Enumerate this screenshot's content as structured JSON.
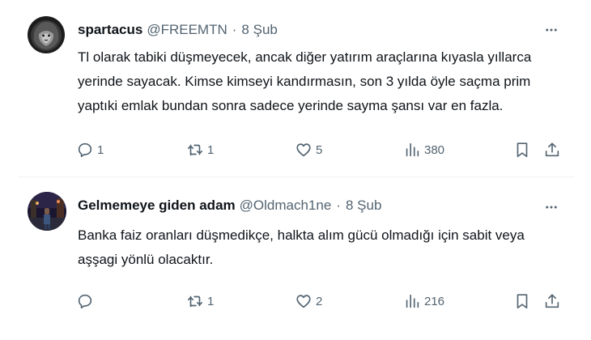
{
  "tweets": [
    {
      "name": "spartacus",
      "handle": "@FREEMTN",
      "separator": "·",
      "date": "8 Şub",
      "text_lines": [
        "Tl olarak tabiki düşmeyecek,  ancak diğer yatırım araçlarına kıyasla yıllarca",
        "yerinde sayacak. Kimse kimseyi kandırmasın, son 3 yılda öyle saçma prim",
        "yaptıki emlak bundan sonra sadece yerinde sayma şansı var en fazla."
      ],
      "replies": "1",
      "retweets": "1",
      "likes": "5",
      "views": "380",
      "avatar_icon": "lion-avatar"
    },
    {
      "name": "Gelmemeye giden adam",
      "handle": "@Oldmach1ne",
      "separator": "·",
      "date": "8 Şub",
      "text_lines": [
        "Banka faiz oranları düşmedikçe, halkta alım gücü olmadığı için  sabit veya",
        "aşşagi yönlü olacaktır."
      ],
      "replies": "",
      "retweets": "1",
      "likes": "2",
      "views": "216",
      "avatar_icon": "night-street-avatar"
    }
  ],
  "icons": {
    "reply": "reply-icon",
    "retweet": "retweet-icon",
    "like": "heart-icon",
    "views": "views-icon",
    "bookmark": "bookmark-icon",
    "share": "share-icon",
    "more": "more-icon"
  }
}
